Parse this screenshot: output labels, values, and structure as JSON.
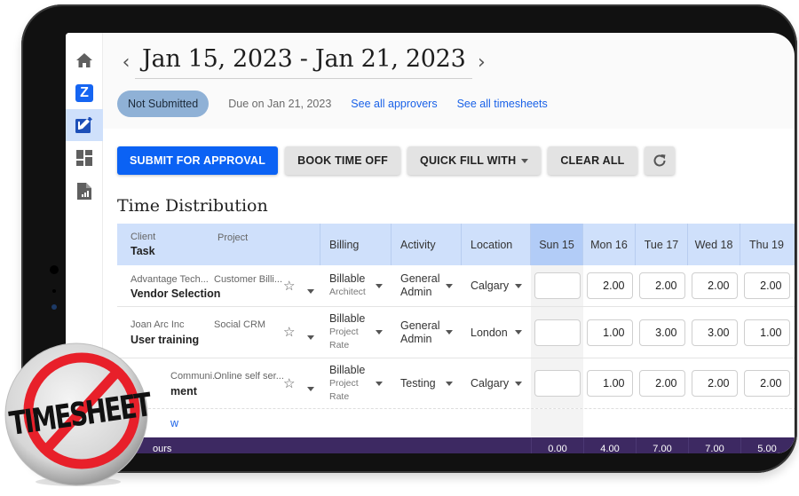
{
  "header": {
    "prev_label": "‹",
    "date_range": "Jan 15, 2023 - Jan 21, 2023",
    "next_label": "›"
  },
  "status": {
    "badge": "Not Submitted",
    "due": "Due on Jan 21, 2023",
    "approvers_link": "See all approvers",
    "timesheets_link": "See all timesheets"
  },
  "toolbar": {
    "submit": "SUBMIT FOR APPROVAL",
    "book_time_off": "BOOK TIME OFF",
    "quick_fill": "QUICK FILL WITH",
    "clear_all": "CLEAR ALL",
    "refresh_icon": "refresh-icon"
  },
  "section_title": "Time Distribution",
  "sidebar": {
    "items": [
      {
        "name": "home",
        "icon": "home-icon"
      },
      {
        "name": "z-app",
        "icon": "z-logo-icon",
        "label": "Z"
      },
      {
        "name": "timesheet",
        "icon": "timesheet-edit-icon",
        "active": true
      },
      {
        "name": "dashboard",
        "icon": "dashboard-icon"
      },
      {
        "name": "reports",
        "icon": "report-icon"
      }
    ]
  },
  "table": {
    "headers": {
      "client": "Client",
      "project": "Project",
      "task": "Task",
      "billing": "Billing",
      "activity": "Activity",
      "location": "Location",
      "days": [
        "Sun 15",
        "Mon 16",
        "Tue 17",
        "Wed 18",
        "Thu 19"
      ]
    },
    "rows": [
      {
        "client": "Advantage Tech...",
        "project": "Customer Billi...",
        "task": "Vendor Selection",
        "billing": "Billable",
        "billing_sub": "Architect",
        "activity_1": "General",
        "activity_2": "Admin",
        "location": "Calgary",
        "hours": [
          "",
          "2.00",
          "2.00",
          "2.00",
          "2.00"
        ]
      },
      {
        "client": "Joan Arc Inc",
        "project": "Social CRM",
        "task": "User training",
        "billing": "Billable",
        "billing_sub_1": "Project",
        "billing_sub_2": "Rate",
        "activity_1": "General",
        "activity_2": "Admin",
        "location": "London",
        "hours": [
          "",
          "1.00",
          "3.00",
          "3.00",
          "1.00"
        ]
      },
      {
        "client": "Communi...",
        "project": "Online self ser...",
        "task": "ment",
        "billing": "Billable",
        "billing_sub_1": "Project",
        "billing_sub_2": "Rate",
        "activity": "Testing",
        "location": "Calgary",
        "hours": [
          "",
          "1.00",
          "2.00",
          "2.00",
          "2.00"
        ]
      }
    ],
    "add_row_link": "w",
    "totals_label": "ours",
    "totals": [
      "0.00",
      "4.00",
      "7.00",
      "7.00",
      "5.00"
    ]
  },
  "overlay_badge": {
    "text": "TIMESHEET",
    "icon": "prohibited-icon",
    "ring_color": "#e8202a",
    "text_color": "#111111"
  },
  "colors": {
    "primary": "#0b62f4",
    "header_bg": "#cfe0fb",
    "totals_bg": "#3d2962",
    "badge_bg": "#8fb1d6",
    "link": "#1a62e8"
  }
}
